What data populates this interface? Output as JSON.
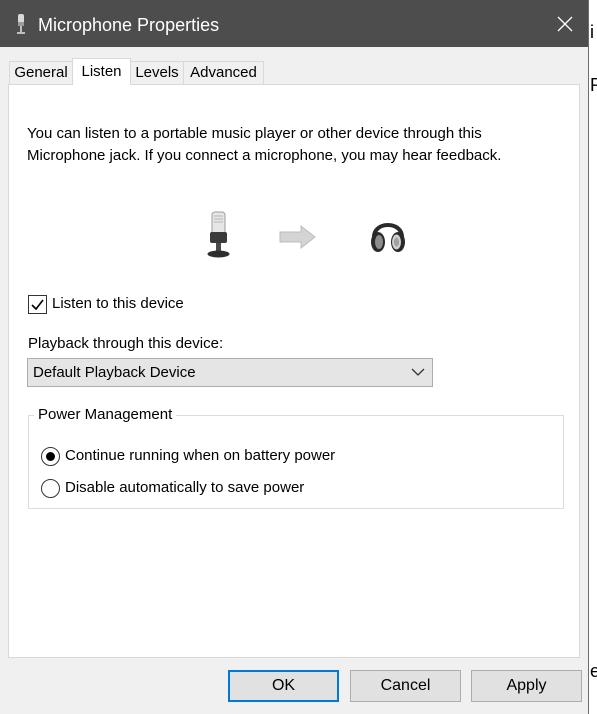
{
  "window": {
    "title": "Microphone Properties"
  },
  "tabs": [
    {
      "label": "General"
    },
    {
      "label": "Listen"
    },
    {
      "label": "Levels"
    },
    {
      "label": "Advanced"
    }
  ],
  "active_tab": "Listen",
  "listen_page": {
    "description_line1": "You can listen to a portable music player or other device through this",
    "description_line2": "Microphone jack.  If you connect a microphone, you may hear feedback.",
    "listen_checkbox_label": "Listen to this device",
    "listen_checked": true,
    "playback_label": "Playback through this device:",
    "playback_device": "Default Playback Device",
    "power_management": {
      "legend": "Power Management",
      "option_continue": "Continue running when on battery power",
      "option_disable": "Disable automatically to save power",
      "selected": "option_continue"
    }
  },
  "buttons": {
    "ok": "OK",
    "cancel": "Cancel",
    "apply": "Apply"
  },
  "background_glyphs": {
    "glyph1": "i",
    "glyph2": "R",
    "glyph3": "e"
  },
  "icons": {
    "title": "microphone-icon",
    "close": "close-icon",
    "source": "microphone-icon",
    "flow": "right-arrow-icon",
    "destination": "headphones-icon",
    "dropdown": "chevron-down-icon"
  },
  "colors": {
    "titlebar": "#4d4d4d",
    "dialog_bg": "#f0f0f0",
    "page_bg": "#ffffff",
    "accent": "#0078d7",
    "button_bg": "#e1e1e1"
  }
}
